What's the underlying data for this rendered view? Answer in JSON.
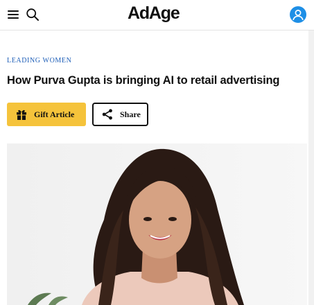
{
  "header": {
    "logo": "AdAge",
    "menu_icon": "hamburger-menu-icon",
    "search_icon": "search-icon",
    "account_icon": "user-account-icon"
  },
  "article": {
    "category": "LEADING WOMEN",
    "title": "How Purva Gupta is bringing AI to retail advertising",
    "gift_label": "Gift Article",
    "share_label": "Share"
  },
  "colors": {
    "gift_button": "#f5c33b",
    "category_link": "#1f5fb8",
    "account_icon": "#1e8fe6"
  }
}
